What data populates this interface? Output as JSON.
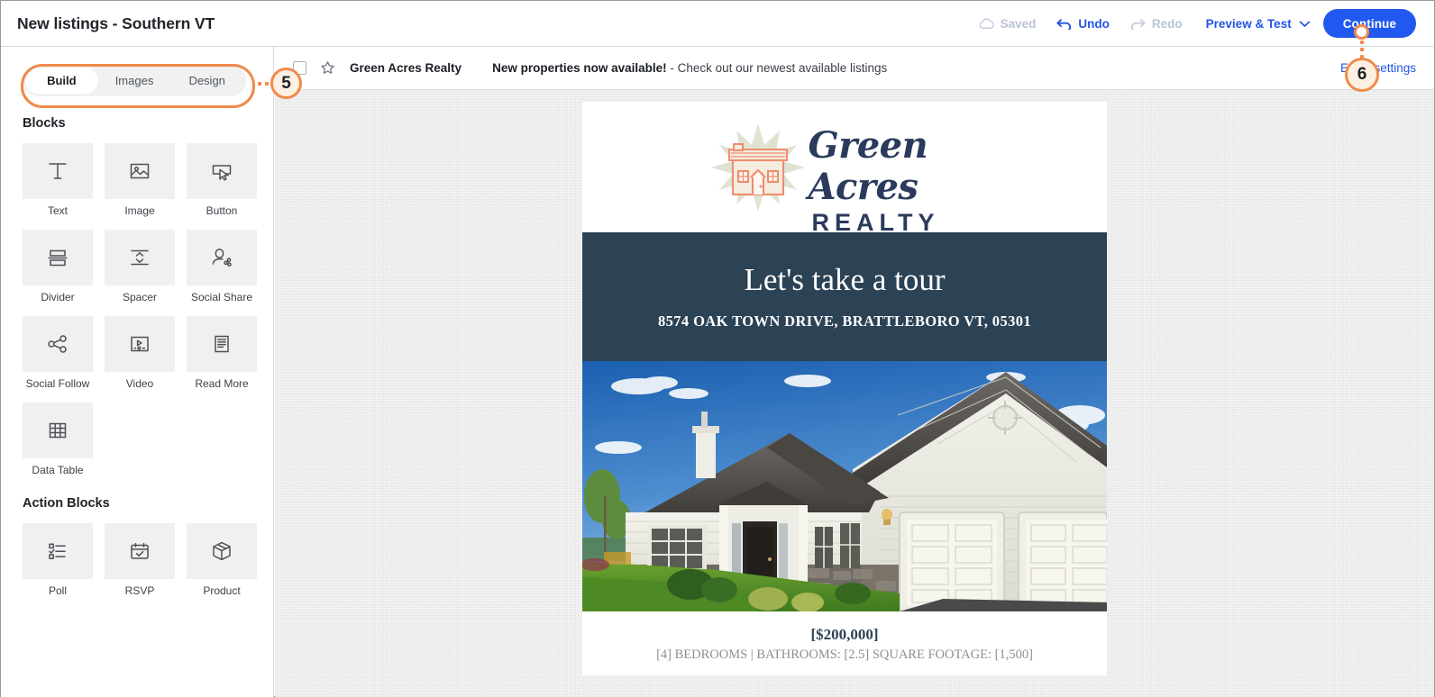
{
  "topbar": {
    "title": "New listings - Southern VT",
    "saved_label": "Saved",
    "undo_label": "Undo",
    "redo_label": "Redo",
    "preview_label": "Preview & Test",
    "continue_label": "Continue"
  },
  "sidebar": {
    "tabs": [
      {
        "label": "Build",
        "active": true
      },
      {
        "label": "Images",
        "active": false
      },
      {
        "label": "Design",
        "active": false
      }
    ],
    "blocks_heading": "Blocks",
    "blocks": [
      {
        "label": "Text",
        "icon": "text-icon"
      },
      {
        "label": "Image",
        "icon": "image-icon"
      },
      {
        "label": "Button",
        "icon": "button-cursor-icon"
      },
      {
        "label": "Divider",
        "icon": "divider-icon"
      },
      {
        "label": "Spacer",
        "icon": "spacer-icon"
      },
      {
        "label": "Social Share",
        "icon": "social-share-icon"
      },
      {
        "label": "Social Follow",
        "icon": "social-follow-icon"
      },
      {
        "label": "Video",
        "icon": "video-icon"
      },
      {
        "label": "Read More",
        "icon": "read-more-icon"
      },
      {
        "label": "Data Table",
        "icon": "data-table-icon"
      }
    ],
    "action_blocks_heading": "Action Blocks",
    "action_blocks": [
      {
        "label": "Poll",
        "icon": "poll-icon"
      },
      {
        "label": "RSVP",
        "icon": "rsvp-calendar-icon"
      },
      {
        "label": "Product",
        "icon": "product-box-icon"
      }
    ]
  },
  "subject_bar": {
    "from_name": "Green Acres Realty",
    "subject_bold": "New properties now available!",
    "subject_rest": " - Check out our newest available listings",
    "email_settings_label": "Email settings"
  },
  "email": {
    "logo_script": "Green Acres",
    "logo_realty": "REALTY",
    "hero_title": "Let's take a tour",
    "hero_subtitle": "8574 OAK TOWN DRIVE, BRATTLEBORO VT, 05301",
    "price": "[$200,000]",
    "specs": "[4] BEDROOMS | BATHROOMS: [2.5] SQUARE FOOTAGE: [1,500]"
  },
  "callouts": [
    {
      "number": "5"
    },
    {
      "number": "6"
    }
  ],
  "colors": {
    "accent_blue": "#2158ef",
    "navy": "#2c4255",
    "callout_orange": "#f08a4b",
    "muted_gray": "#b9c3d4",
    "tile_gray": "#f0f0f0"
  }
}
